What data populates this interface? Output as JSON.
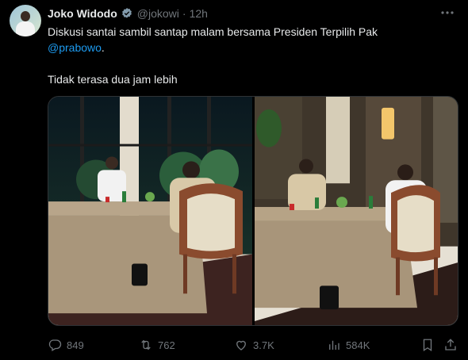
{
  "tweet": {
    "author_name": "Joko Widodo",
    "handle": "@jokowi",
    "separator": "·",
    "time": "12h",
    "text_line1": "Diskusi santai sambil santap malam bersama Presiden Terpilih Pak",
    "mention": "@prabowo",
    "mention_suffix": ".",
    "text_line2": "Tidak terasa dua jam lebih"
  },
  "stats": {
    "replies": "849",
    "reposts": "762",
    "likes": "3.7K",
    "views": "584K"
  },
  "colors": {
    "background": "#000000",
    "text": "#e7e9ea",
    "muted": "#71767b",
    "link": "#1d9bf0",
    "verified": "#829aab"
  },
  "icons": [
    "verified-badge-icon",
    "more-icon",
    "reply-icon",
    "repost-icon",
    "like-icon",
    "views-icon",
    "bookmark-icon",
    "share-icon"
  ]
}
